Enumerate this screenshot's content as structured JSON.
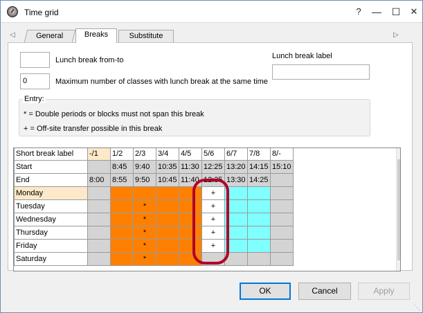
{
  "window": {
    "title": "Time grid",
    "help": "?",
    "minimize": "—",
    "maximize": "☐",
    "close": "✕"
  },
  "tabs": [
    "General",
    "Breaks",
    "Substitute"
  ],
  "form": {
    "lunch_from_label": "Lunch break from-to",
    "lunch_from_value": "",
    "max_classes_value": "0",
    "max_classes_label": "Maximum number of classes with lunch break at the same time",
    "lunch_label_title": "Lunch break label",
    "lunch_label_value": ""
  },
  "entry": {
    "title": "Entry:",
    "line1": "* = Double periods or blocks must not span this break",
    "line2": "+ = Off-site transfer possible in this break"
  },
  "grid": {
    "columns": [
      "-/1",
      "1/2",
      "2/3",
      "3/4",
      "4/5",
      "5/6",
      "6/7",
      "7/8",
      "8/-"
    ],
    "start": [
      "",
      "8:45",
      "9:40",
      "10:35",
      "11:30",
      "12:25",
      "13:20",
      "14:15",
      "15:10"
    ],
    "end": [
      "8:00",
      "8:55",
      "9:50",
      "10:45",
      "11:40",
      "12:35",
      "13:30",
      "14:25",
      ""
    ],
    "row_labels": {
      "hidden": "Short break label",
      "start": "Start",
      "end": "End"
    },
    "days": [
      {
        "name": "Monday",
        "marks": [
          "",
          "",
          "",
          "",
          "",
          "+",
          "",
          "",
          ""
        ]
      },
      {
        "name": "Tuesday",
        "marks": [
          "",
          "",
          "*",
          "",
          "",
          "+",
          "",
          "",
          ""
        ]
      },
      {
        "name": "Wednesday",
        "marks": [
          "",
          "",
          "*",
          "",
          "",
          "+",
          "",
          "",
          ""
        ]
      },
      {
        "name": "Thursday",
        "marks": [
          "",
          "",
          "*",
          "",
          "",
          "+",
          "",
          "",
          ""
        ]
      },
      {
        "name": "Friday",
        "marks": [
          "",
          "",
          "*",
          "",
          "",
          "+",
          "",
          "",
          ""
        ]
      },
      {
        "name": "Saturday",
        "marks": [
          "",
          "",
          "*",
          "",
          "",
          "",
          "",
          "",
          ""
        ]
      }
    ]
  },
  "buttons": {
    "ok": "OK",
    "cancel": "Cancel",
    "apply": "Apply"
  },
  "colors": {
    "lunch": "#ff8000",
    "transfer": "#80ffff",
    "selected_row": "#fde9c9",
    "highlight": "#b0002a"
  }
}
